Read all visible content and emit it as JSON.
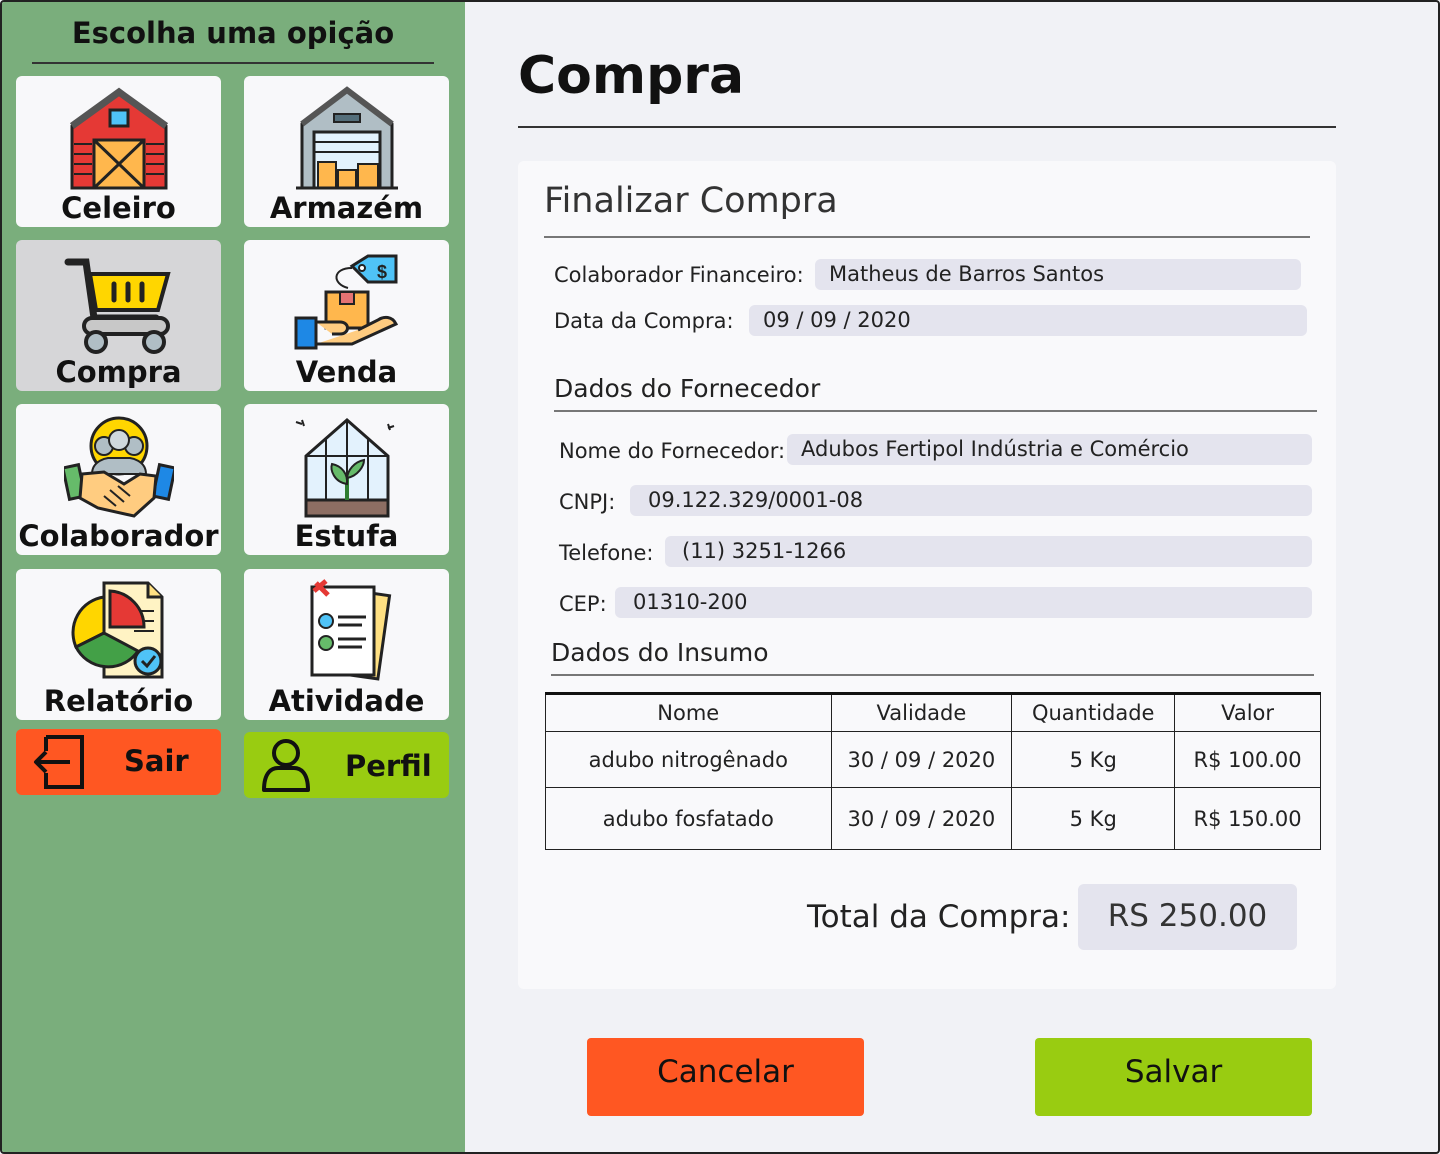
{
  "sidebar": {
    "title": "Escolha uma opição",
    "tiles": [
      {
        "label": "Celeiro",
        "icon": "barn-icon"
      },
      {
        "label": "Armazém",
        "icon": "warehouse-icon"
      },
      {
        "label": "Compra",
        "icon": "cart-icon",
        "active": true
      },
      {
        "label": "Venda",
        "icon": "sale-box-hand-icon"
      },
      {
        "label": "Colaborador",
        "icon": "handshake-team-icon"
      },
      {
        "label": "Estufa",
        "icon": "greenhouse-icon"
      },
      {
        "label": "Relatório",
        "icon": "report-pie-chart-icon"
      },
      {
        "label": "Atividade",
        "icon": "checklist-icon"
      }
    ],
    "logout": {
      "label": "Sair",
      "icon": "logout-icon",
      "color": "#FF5722"
    },
    "profile": {
      "label": "Perfil",
      "icon": "user-icon",
      "color": "#99CC11"
    }
  },
  "page": {
    "title": "Compra"
  },
  "form": {
    "title": "Finalizar Compra",
    "collaborator": {
      "label": "Colaborador Financeiro:",
      "value": "Matheus de Barros Santos"
    },
    "date": {
      "label": "Data da Compra:",
      "value": "09 / 09 / 2020"
    },
    "supplier": {
      "title": "Dados do Fornecedor",
      "name": {
        "label": "Nome do Fornecedor:",
        "value": "Adubos Fertipol Indústria e Comércio"
      },
      "cnpj": {
        "label": "CNPJ:",
        "value": "09.122.329/0001-08"
      },
      "phone": {
        "label": "Telefone:",
        "value": "(11) 3251-1266"
      },
      "cep": {
        "label": "CEP:",
        "value": "01310-200"
      }
    },
    "items": {
      "title": "Dados do Insumo",
      "columns": [
        "Nome",
        "Validade",
        "Quantidade",
        "Valor"
      ],
      "rows": [
        [
          "adubo nitrogênado",
          "30 / 09 / 2020",
          "5 Kg",
          "R$ 100.00"
        ],
        [
          "adubo fosfatado",
          "30 / 09 / 2020",
          "5 Kg",
          "R$ 150.00"
        ]
      ]
    },
    "total": {
      "label": "Total da Compra:",
      "value": "RS 250.00"
    }
  },
  "actions": {
    "cancel": {
      "label": "Cancelar",
      "color": "#FF5722"
    },
    "save": {
      "label": "Salvar",
      "color": "#99CC11"
    }
  }
}
